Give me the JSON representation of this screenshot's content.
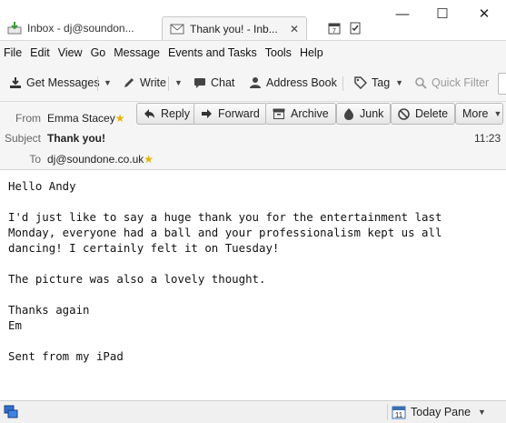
{
  "tabs": [
    {
      "label": "Inbox - dj@soundon...",
      "icon": "inbox-icon"
    },
    {
      "label": "Thank you! - Inb...",
      "icon": "envelope-icon",
      "close": "✕"
    }
  ],
  "window": {
    "minimize": "—",
    "maximize": "☐",
    "close": "✕"
  },
  "menu": [
    "File",
    "Edit",
    "View",
    "Go",
    "Message",
    "Events and Tasks",
    "Tools",
    "Help"
  ],
  "toolbar": {
    "get_messages": "Get Messages",
    "write": "Write",
    "chat": "Chat",
    "address_book": "Address Book",
    "tag": "Tag",
    "quick_filter": "Quick Filter"
  },
  "header": {
    "from_label": "From",
    "from_value": "Emma Stacey",
    "subject_label": "Subject",
    "subject_value": "Thank you!",
    "to_label": "To",
    "to_value": "dj@soundone.co.uk",
    "time": "11:23",
    "buttons": {
      "reply": "Reply",
      "forward": "Forward",
      "archive": "Archive",
      "junk": "Junk",
      "delete": "Delete",
      "more": "More"
    }
  },
  "message": {
    "body": "Hello Andy\n\nI'd just like to say a huge thank you for the entertainment last\nMonday, everyone had a ball and your professionalism kept us all\ndancing! I certainly felt it on Tuesday!\n\nThe picture was also a lovely thought.\n\nThanks again\nEm\n\nSent from my iPad"
  },
  "status": {
    "today_pane": "Today Pane",
    "calendar_day": "11"
  },
  "colors": {
    "star": "#e8b400",
    "accent": "#1a6fc8"
  }
}
